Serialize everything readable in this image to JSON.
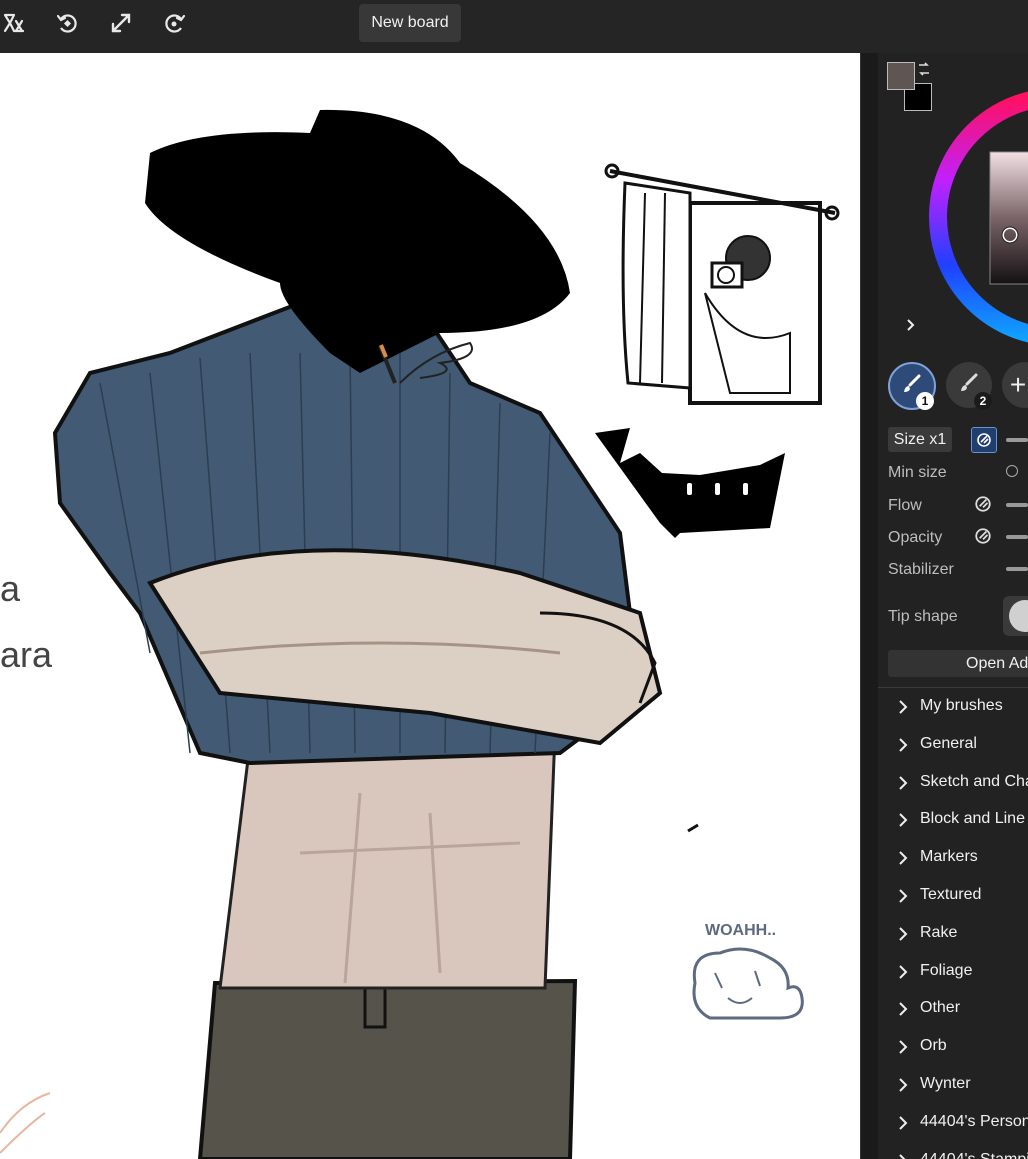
{
  "toolbar": {
    "icons": [
      "reference-icon",
      "redo-icon",
      "fullscreen-icon",
      "rotate-view-icon"
    ],
    "new_board_label": "New board"
  },
  "canvas": {
    "handwriting": [
      "a",
      "ara"
    ],
    "doodle_caption": "WOAHH.."
  },
  "colors": {
    "foreground": "#5f5552",
    "background": "#000000"
  },
  "brushes": {
    "slots": [
      {
        "number": "1",
        "active": true
      },
      {
        "number": "2",
        "active": false
      }
    ],
    "add_label": "+"
  },
  "properties": {
    "size_label": "Size x1",
    "min_size_label": "Min size",
    "flow_label": "Flow",
    "opacity_label": "Opacity",
    "stabilizer_label": "Stabilizer",
    "tip_shape_label": "Tip shape",
    "open_advanced_label": "Open Ad"
  },
  "brush_groups": [
    "My brushes",
    "General",
    "Sketch and Cha",
    "Block and Line",
    "Markers",
    "Textured",
    "Rake",
    "Foliage",
    "Other",
    "Orb",
    "Wynter",
    "44404's Person",
    "44404's Stampi"
  ]
}
